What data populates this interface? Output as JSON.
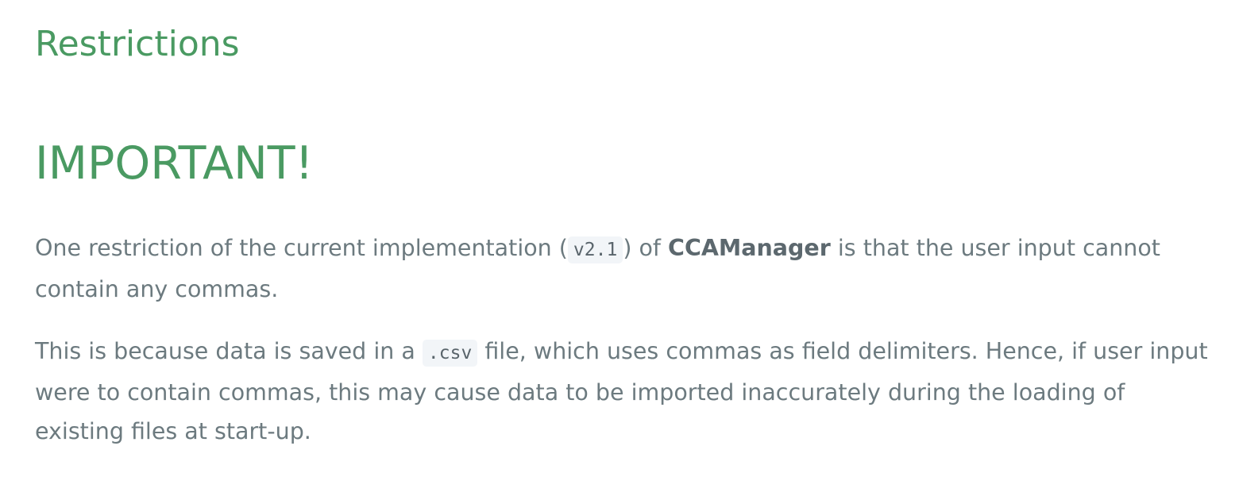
{
  "section": {
    "title": "Restrictions"
  },
  "important": {
    "heading": "IMPORTANT!"
  },
  "paragraph1": {
    "text_before_version": "One restriction of the current implementation (",
    "version": "v2.1",
    "text_after_version": ") of ",
    "product_name": "CCAManager",
    "text_end": " is that the user input cannot contain any commas."
  },
  "paragraph2": {
    "text_before_ext": "This is because data is saved in a ",
    "file_extension": ".csv",
    "text_after_ext": " file, which uses commas as field delimiters. Hence, if user input were to contain commas, this may cause data to be imported inaccurately during the loading of existing files at start-up."
  }
}
